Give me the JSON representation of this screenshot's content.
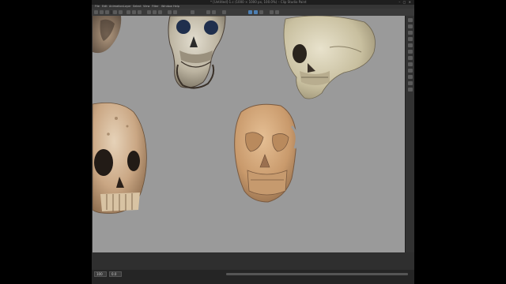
{
  "window": {
    "title": "* [Untitled]-1.c (1000 × 1000 px, 100.0%) – Clip Studio Paint",
    "controls": "–  ▢  ✕"
  },
  "menu": {
    "items": [
      "File",
      "Edit",
      "Animation",
      "Layer",
      "Select",
      "View",
      "Filter",
      "Window",
      "Help"
    ]
  },
  "status": {
    "zoom": "100",
    "angle": "0.0"
  },
  "colors": {
    "canvas": "#9a9a9a",
    "ui_dark": "#2b2b2b",
    "accent": "#4d7fb3"
  }
}
